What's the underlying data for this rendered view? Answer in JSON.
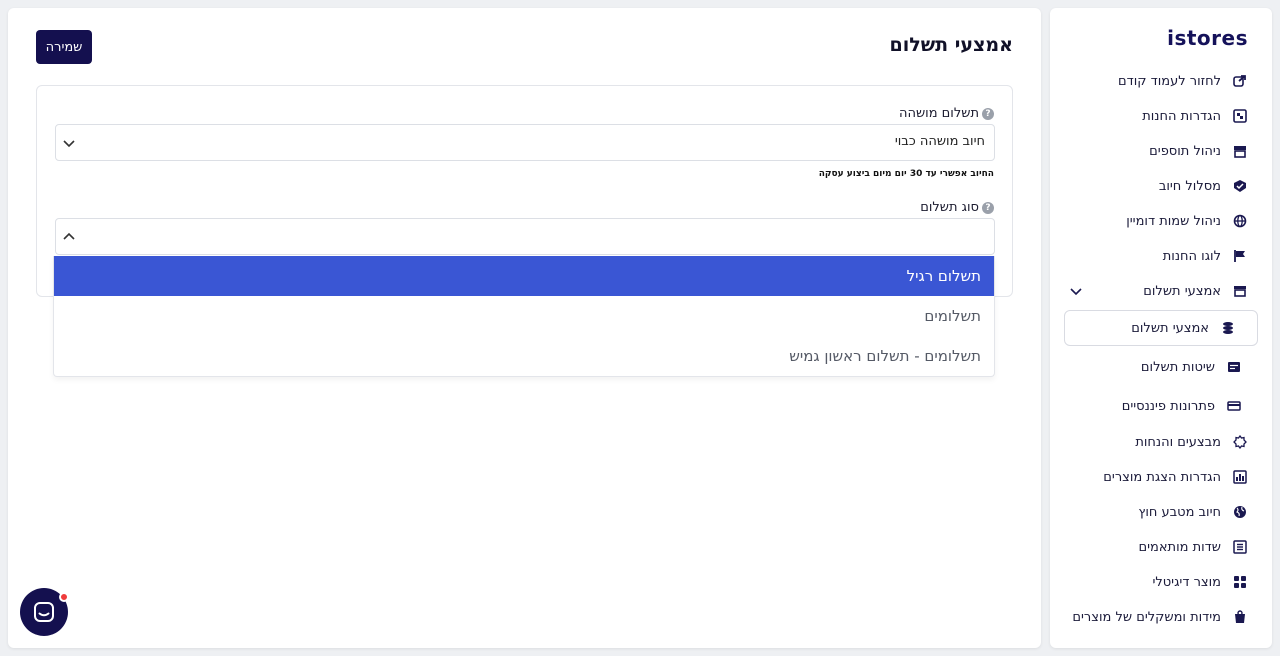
{
  "brand": {
    "logo_text": "istores"
  },
  "sidebar": {
    "items": [
      {
        "label": "לחזור לעמוד קודם",
        "icon": "back-icon"
      },
      {
        "label": "הגדרות החנות",
        "icon": "store-settings-icon"
      },
      {
        "label": "ניהול תוספים",
        "icon": "plugins-icon"
      },
      {
        "label": "מסלול חיוב",
        "icon": "billing-plan-icon"
      },
      {
        "label": "ניהול שמות דומיין",
        "icon": "domain-icon"
      },
      {
        "label": "לוגו החנות",
        "icon": "flag-icon"
      },
      {
        "label": "אמצעי תשלום",
        "icon": "payment-methods-icon"
      }
    ],
    "sub_items": [
      {
        "label": "אמצעי תשלום",
        "icon": "coins-icon"
      },
      {
        "label": "שיטות תשלום",
        "icon": "payment-form-icon"
      },
      {
        "label": "פתרונות פיננסיים",
        "icon": "credit-card-icon"
      }
    ],
    "more_items": [
      {
        "label": "מבצעים והנחות",
        "icon": "promotions-icon"
      },
      {
        "label": "הגדרות הצגת מוצרים",
        "icon": "product-display-icon"
      },
      {
        "label": "חיוב מטבע חוץ",
        "icon": "globe-icon"
      },
      {
        "label": "שדות מותאמים",
        "icon": "custom-fields-icon"
      },
      {
        "label": "מוצר דיגיטלי",
        "icon": "digital-product-icon"
      },
      {
        "label": "מידות ומשקלים של מוצרים",
        "icon": "weights-icon"
      }
    ]
  },
  "main": {
    "title": "אמצעי תשלום",
    "save_label": "שמירה",
    "deferred": {
      "label": "תשלום מושהה",
      "value": "חיוב מושהה כבוי",
      "helper": "החיוב אפשרי עד 30 יום מיום ביצוע עסקה"
    },
    "payment_type": {
      "label": "סוג תשלום",
      "value": "",
      "options": [
        "תשלום רגיל",
        "תשלומים",
        "תשלומים - תשלום ראשון גמיש"
      ],
      "highlighted_index": 0
    }
  },
  "colors": {
    "brand_navy": "#14104f",
    "highlight_blue": "#3a56d4",
    "notification_red": "#ef3b3b"
  }
}
